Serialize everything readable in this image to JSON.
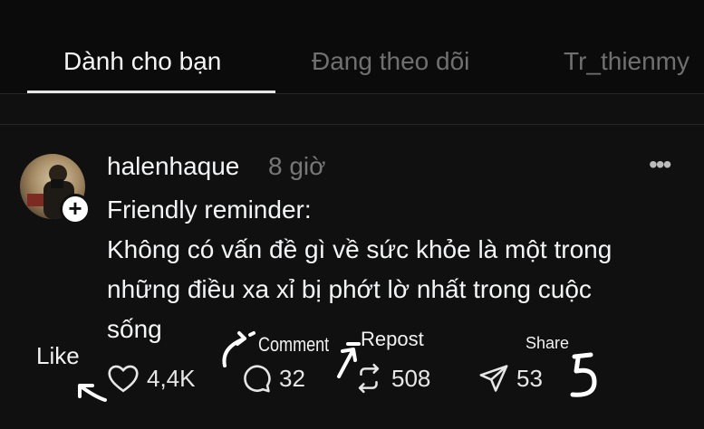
{
  "tabs": [
    {
      "label": "Dành cho bạn",
      "active": true
    },
    {
      "label": "Đang theo dõi",
      "active": false
    },
    {
      "label": "Tr_thienmy",
      "active": false
    }
  ],
  "post": {
    "username": "halenhaque",
    "time": "8 giờ",
    "more_label": "•••",
    "follow_label": "+",
    "text_lines": [
      "Friendly reminder:",
      "Không có vấn đề gì về sức khỏe là một trong",
      "những điều xa xỉ bị phớt lờ nhất trong cuộc",
      "sống"
    ],
    "actions": {
      "like": {
        "count": "4,4K",
        "icon": "heart-icon"
      },
      "comment": {
        "count": "32",
        "icon": "comment-bubble-icon"
      },
      "repost": {
        "count": "508",
        "icon": "repost-icon"
      },
      "share": {
        "count": "53",
        "icon": "send-icon"
      }
    }
  },
  "annotations": {
    "like": "Like",
    "comment": "Comment",
    "repost": "Repost",
    "share": "Share"
  },
  "colors": {
    "background": "#101010",
    "text": "#f3f5f7",
    "muted": "#777777"
  }
}
